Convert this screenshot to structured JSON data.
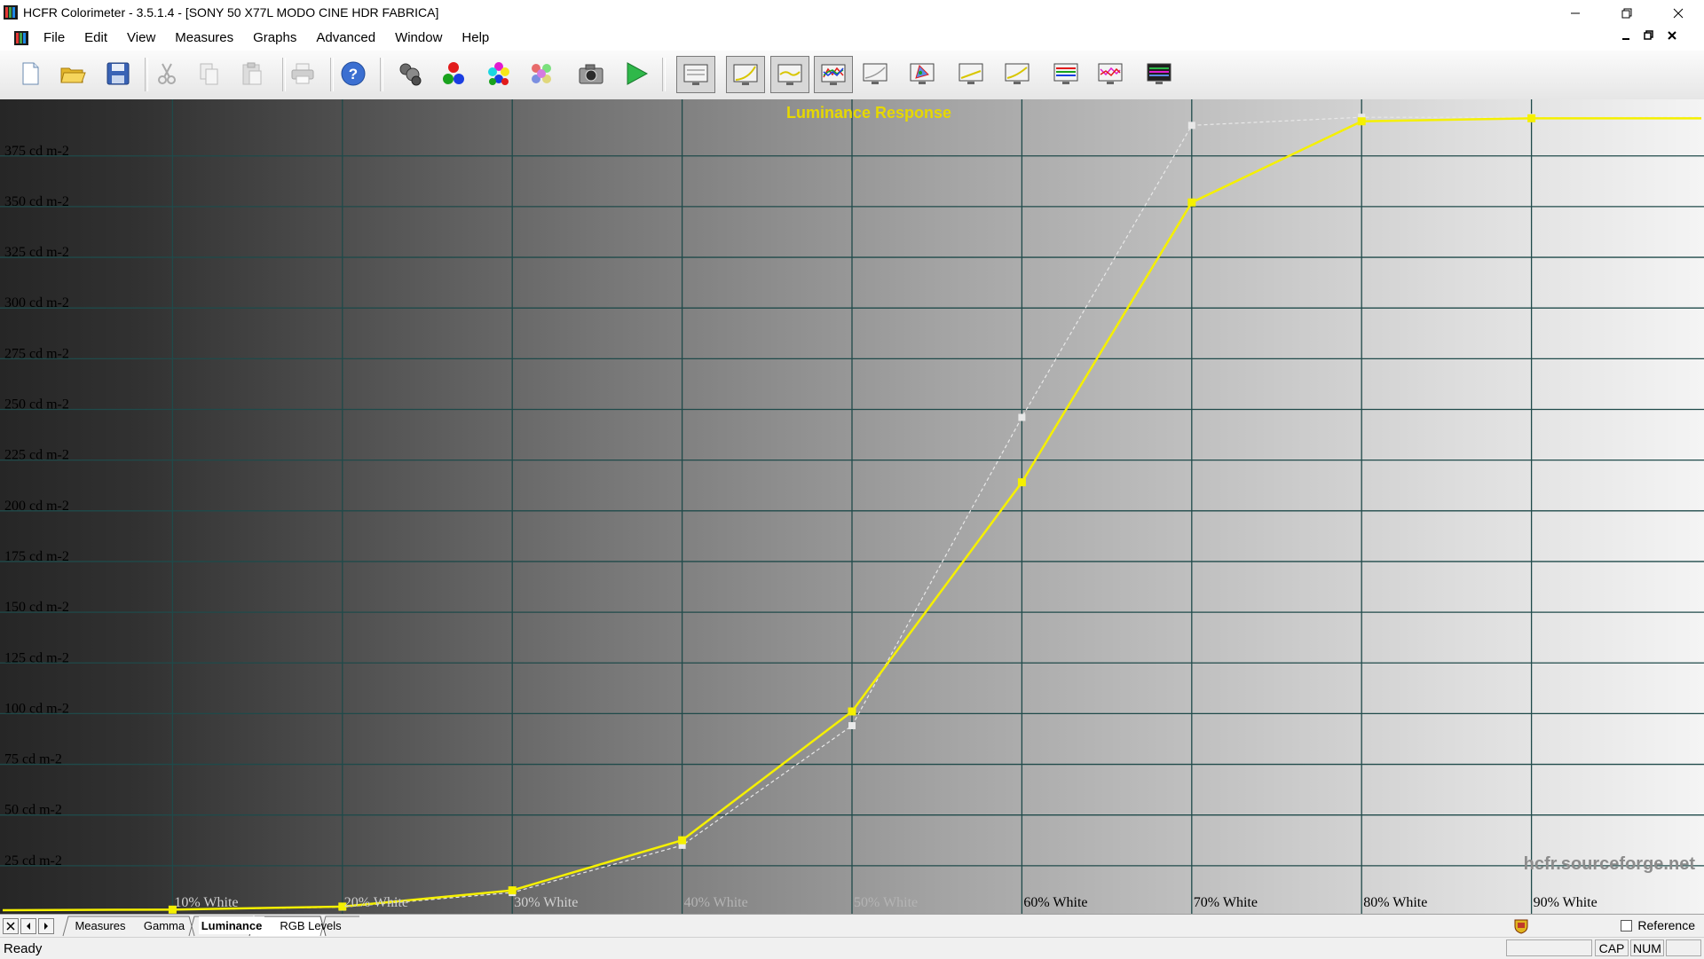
{
  "window": {
    "title": "HCFR Colorimeter - 3.5.1.4 - [SONY 50 X77L MODO CINE HDR FABRICA]"
  },
  "menu": [
    "File",
    "Edit",
    "View",
    "Measures",
    "Graphs",
    "Advanced",
    "Window",
    "Help"
  ],
  "toolbar_icons": [
    "new-file-icon",
    "open-folder-icon",
    "save-icon",
    "cut-icon",
    "copy-icon",
    "paste-icon",
    "print-icon",
    "help-icon",
    "measure-probe-icon",
    "rgb-primaries-icon",
    "secondaries-icon",
    "saturation-icon",
    "camera-icon",
    "play-icon",
    "view-measures-icon",
    "view-gamma-icon",
    "view-luminance-icon",
    "view-rgb-levels-icon",
    "view-color-temp-icon",
    "view-cie-icon",
    "view-delta-e-icon",
    "view-delta-e2-icon",
    "view-saturation-shift-icon",
    "view-near-black-icon",
    "view-near-white-icon"
  ],
  "chart_data": {
    "type": "line",
    "title": "Luminance Response",
    "watermark": "hcfr.sourceforge.net",
    "y_unit": "cd m-2",
    "ylim": [
      0,
      400
    ],
    "yticks": [
      25,
      50,
      75,
      100,
      125,
      150,
      175,
      200,
      225,
      250,
      275,
      300,
      325,
      350,
      375
    ],
    "ytick_labels": [
      "25 cd m-2",
      "50 cd m-2",
      "75 cd m-2",
      "100 cd m-2",
      "125 cd m-2",
      "150 cd m-2",
      "175 cd m-2",
      "200 cd m-2",
      "225 cd m-2",
      "250 cd m-2",
      "275 cd m-2",
      "300 cd m-2",
      "325 cd m-2",
      "350 cd m-2",
      "375 cd m-2"
    ],
    "x": [
      0,
      10,
      20,
      30,
      40,
      50,
      60,
      70,
      80,
      90,
      100
    ],
    "xtick_labels": [
      "10% White",
      "20% White",
      "30% White",
      "40% White",
      "50% White",
      "60% White",
      "70% White",
      "80% White",
      "90% White"
    ],
    "grid": true,
    "series": [
      {
        "color": "#f5f000",
        "values": [
          0.0,
          0.3,
          1.8,
          9.8,
          34.5,
          98.0,
          211.0,
          349.0,
          389.0,
          390.5,
          390.5
        ]
      },
      {
        "color": "#e8e8e8",
        "dashed": true,
        "values": [
          0.0,
          0.2,
          1.5,
          8.7,
          32.0,
          91.0,
          243.0,
          387.0,
          391.0,
          391.0,
          391.0
        ]
      }
    ]
  },
  "tabs": [
    "Measures",
    "Gamma",
    "Luminance",
    "RGB Levels"
  ],
  "active_tab": "Luminance",
  "reference_label": "Reference",
  "status": {
    "text": "Ready",
    "cap": "CAP",
    "num": "NUM"
  }
}
